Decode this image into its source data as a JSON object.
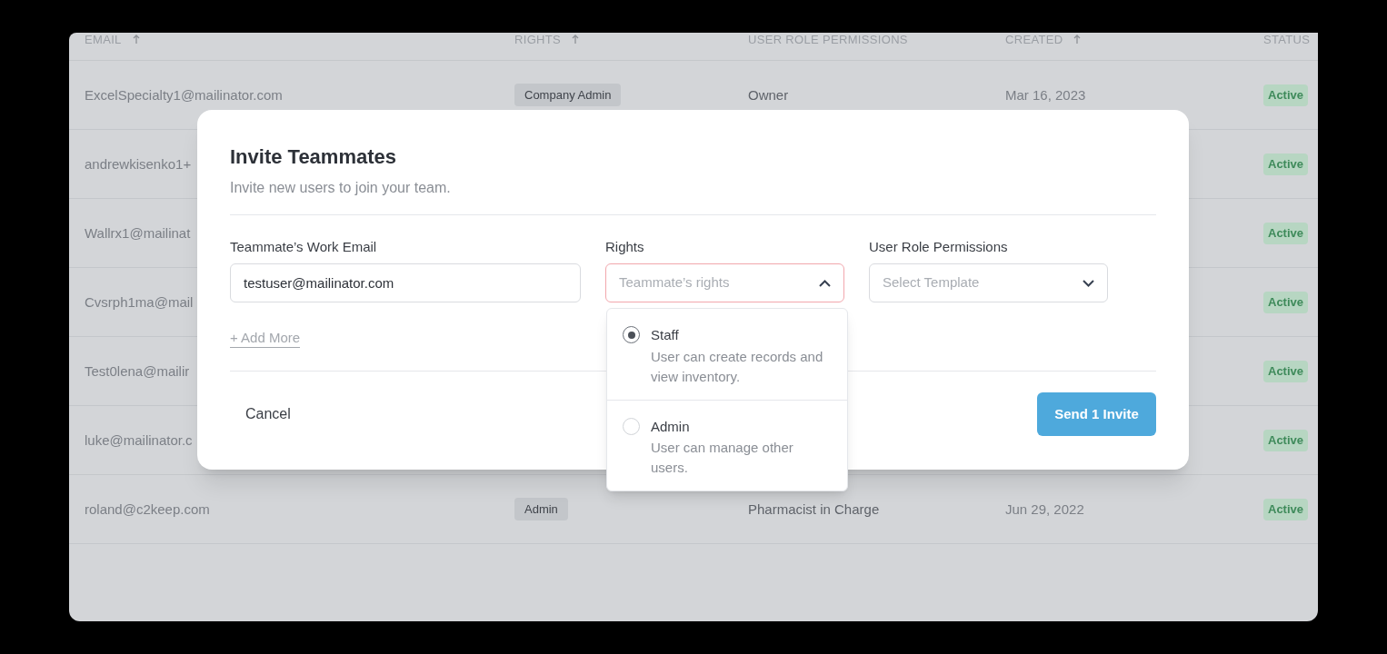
{
  "table": {
    "columns": [
      {
        "label": "EMAIL",
        "sort_icon": true
      },
      {
        "label": "RIGHTS",
        "sort_icon": true
      },
      {
        "label": "USER ROLE PERMISSIONS",
        "sort_icon": false
      },
      {
        "label": "CREATED",
        "sort_icon": true
      },
      {
        "label": "STATUS",
        "sort_icon": false
      }
    ],
    "rows": [
      {
        "email": "ExcelSpecialty1@mailinator.com",
        "rights": "Company Admin",
        "role": "Owner",
        "created": "Mar 16, 2023",
        "status": "Active"
      },
      {
        "email": "andrewkisenko1+",
        "status": "Active"
      },
      {
        "email": "Wallrx1@mailinat",
        "status": "Active"
      },
      {
        "email": "Cvsrph1ma@mail",
        "status": "Active"
      },
      {
        "email": "Test0lena@mailir",
        "status": "Active"
      },
      {
        "email": "luke@mailinator.c",
        "status": "Active"
      },
      {
        "email": "roland@c2keep.com",
        "rights": "Admin",
        "role": "Pharmacist in Charge",
        "created": "Jun 29, 2022",
        "status": "Active"
      }
    ]
  },
  "modal": {
    "title": "Invite Teammates",
    "subtitle": "Invite new users to join your team.",
    "fields": [
      {
        "kind": "text",
        "label": "Teammate’s Work Email",
        "value": "testuser@mailinator.com"
      },
      {
        "kind": "select",
        "label": "Rights",
        "placeholder": "Teammate’s rights",
        "expanded": true
      },
      {
        "kind": "select",
        "label": "User Role Permissions",
        "placeholder": "Select Template",
        "expanded": false
      }
    ],
    "add_more": "+ Add More",
    "rights_options": [
      {
        "label": "Staff",
        "description": "User can create records and view inventory.",
        "selected": true
      },
      {
        "label": "Admin",
        "description": "User can manage other users.",
        "selected": false
      }
    ],
    "cancel": "Cancel",
    "submit": "Send 1 Invite"
  }
}
